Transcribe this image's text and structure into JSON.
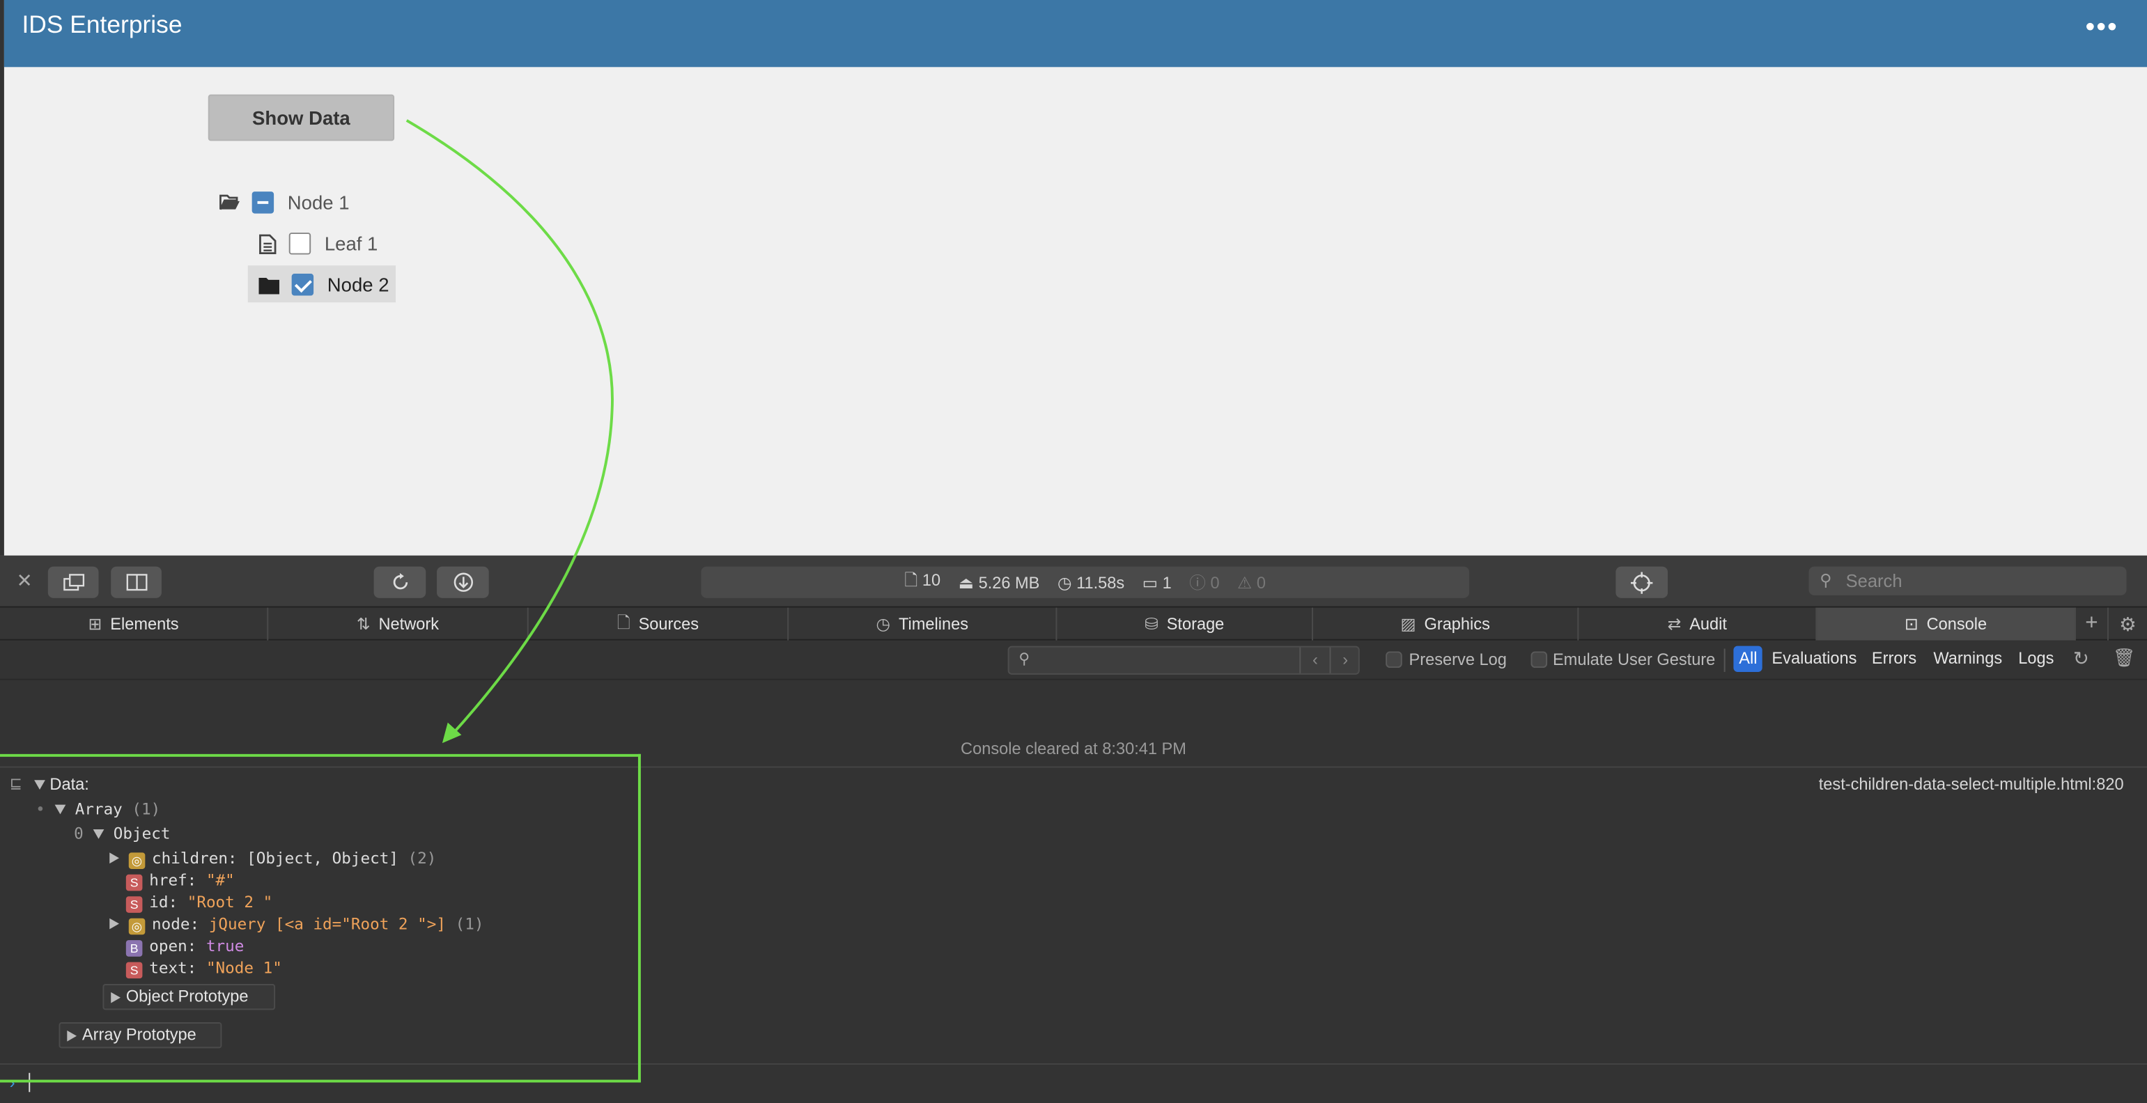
{
  "app": {
    "title": "IDS Enterprise",
    "menu_icon": "kebab-icon"
  },
  "page": {
    "show_button": "Show Data",
    "tree": [
      {
        "label": "Node 1",
        "icon": "folder-open-icon",
        "state": "partial"
      },
      {
        "label": "Leaf 1",
        "icon": "document-icon",
        "state": "unchecked"
      },
      {
        "label": "Node 2",
        "icon": "folder-icon",
        "state": "checked"
      }
    ]
  },
  "devtools": {
    "dashboard": {
      "resources": "10",
      "size": "5.26 MB",
      "time": "11.58s",
      "logs": "1",
      "errors": "0",
      "warnings": "0"
    },
    "search_placeholder": "Search",
    "tabs": [
      "Elements",
      "Network",
      "Sources",
      "Timelines",
      "Storage",
      "Graphics",
      "Audit",
      "Console"
    ],
    "filter": {
      "preserve_log": "Preserve Log",
      "emulate_gesture": "Emulate User Gesture",
      "levels": [
        "All",
        "Evaluations",
        "Errors",
        "Warnings",
        "Logs"
      ]
    },
    "console": {
      "cleared": "Console cleared at 8:30:41 PM",
      "source": "test-children-data-select-multiple.html:820",
      "data_label": "Data:",
      "array_label": "Array",
      "array_count": "(1)",
      "index": "0",
      "object_label": "Object",
      "props": [
        {
          "key": "children:",
          "val": "[Object, Object]",
          "count": "(2)",
          "badge": "O"
        },
        {
          "key": "href:",
          "val": "\"#\"",
          "badge": "S"
        },
        {
          "key": "id:",
          "val": "\"Root 2 \"",
          "badge": "S"
        },
        {
          "key": "node:",
          "val": "jQuery [<a id=\"Root 2 \">]",
          "count": "(1)",
          "badge": "O"
        },
        {
          "key": "open:",
          "val": "true",
          "badge": "B"
        },
        {
          "key": "text:",
          "val": "\"Node 1\"",
          "badge": "S"
        }
      ],
      "object_prototype": "Object Prototype",
      "array_prototype": "Array Prototype"
    }
  },
  "colors": {
    "header": "#3c77a6",
    "annotation": "#6ddb47",
    "accent": "#4a84bf"
  }
}
